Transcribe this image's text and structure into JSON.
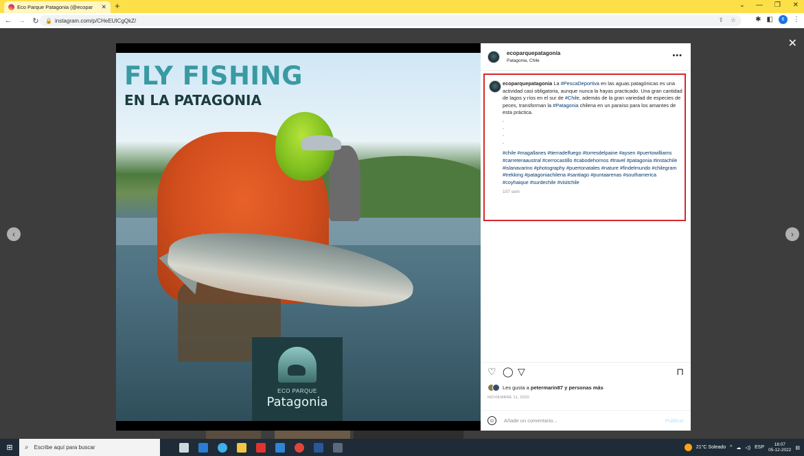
{
  "browser": {
    "tab_title": "Eco Parque Patagonia (@ecopar",
    "tab_close": "✕",
    "new_tab": "+",
    "url": "instagram.com/p/CHeEUICgQkZ/",
    "profile_initial": "6",
    "controls": {
      "minimize": "—",
      "maximize": "❐",
      "close": "✕",
      "tab_search": "⌄"
    }
  },
  "post": {
    "image": {
      "title": "FLY FISHING",
      "subtitle": "EN LA PATAGONIA",
      "logo_line1": "ECO PARQUE",
      "logo_line2": "Patagonia"
    },
    "header": {
      "username": "ecoparquepatagonia",
      "location": "Patagonia, Chile",
      "more": "•••"
    },
    "caption": {
      "username": "ecoparquepatagonia",
      "part1": " La ",
      "tag1": "#PescaDeportiva",
      "part2": " en las aguas patagónicas es una actividad casi obligatoria, aunque nunca la hayas practicado. Una gran cantidad de lagos y ríos en el sur de ",
      "tag2": "#Chile",
      "part3": ", además de la gran variedad de especies de peces, transforman la ",
      "tag3": "#Patagonia",
      "part4": " chilena en un paraíso para los amantes de esta práctica.",
      "hashtags": "#chile #magallanes #tierradelfuego #torresdelpaine #aysen #puertowilliams #carreteraaustral #cerrocastillo #cabodehornos #travel #patagonia #instachile #islanavarino #photography #puertonatales #nature #findelmundo #chilegram #trekking #patagoniachilena #santiago #puntaarenas #southamerica #coyhaique #surdechile #visitchile",
      "time": "107 sem"
    },
    "likes_text": "Les gusta a ",
    "likes_user": "petermarin87",
    "likes_suffix": " y personas más",
    "date": "NOVIEMBRE 11, 2020",
    "comment_placeholder": "Añade un comentario...",
    "publish_label": "Publicar"
  },
  "overlay": {
    "close": "✕",
    "prev": "‹",
    "next": "›"
  },
  "taskbar": {
    "search_placeholder": "Escribe aquí para buscar",
    "weather": "21°C  Soleado",
    "lang": "ESP",
    "time": "18:07",
    "date": "05-12-2022"
  }
}
